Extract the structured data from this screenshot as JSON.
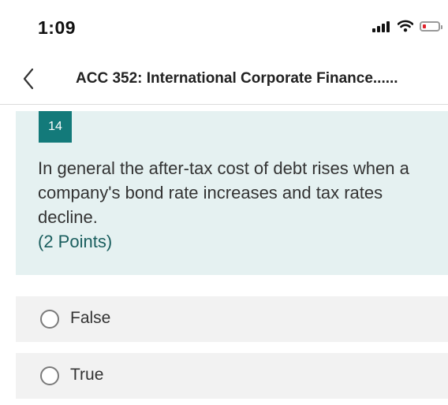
{
  "status_bar": {
    "time": "1:09",
    "icons": [
      "signal-icon",
      "wifi-icon",
      "battery-icon"
    ],
    "battery_color": "#e0232c"
  },
  "header": {
    "back_icon": "chevron-left-icon",
    "title": "ACC 352: International Corporate Finance......"
  },
  "question": {
    "number": "14",
    "text": "In general the after-tax cost of debt rises when a company's bond rate increases and tax rates decline.",
    "points": "(2 Points)",
    "accent_color": "#137a7a",
    "card_background": "#e5f1f1"
  },
  "options": [
    {
      "label": "False",
      "selected": false
    },
    {
      "label": "True",
      "selected": false
    }
  ]
}
